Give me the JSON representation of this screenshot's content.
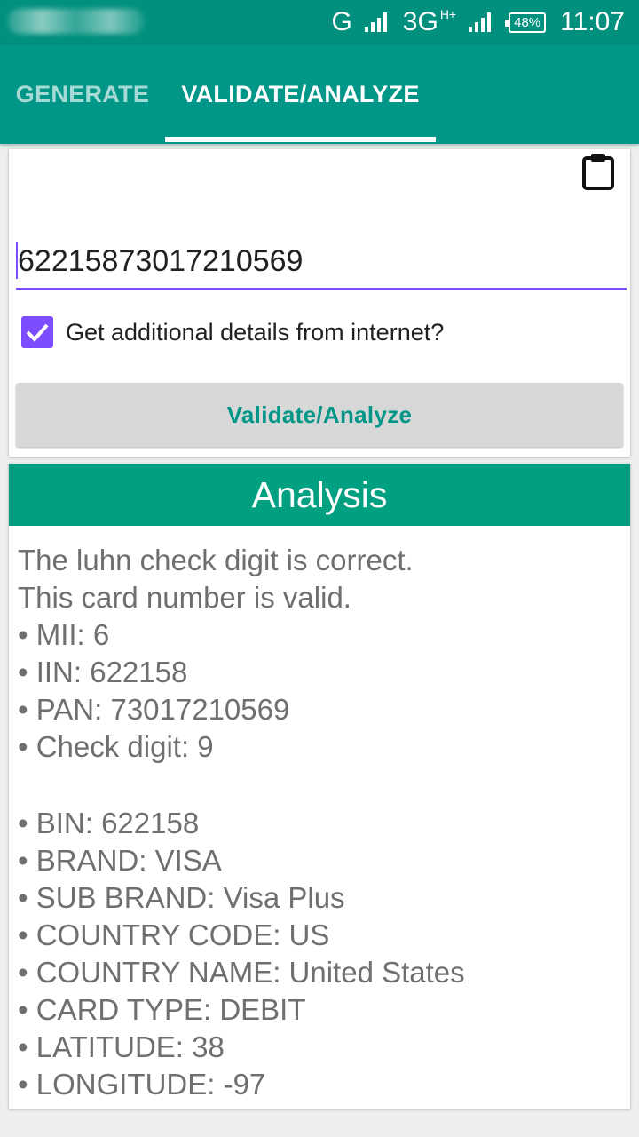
{
  "status_bar": {
    "network_g": "G",
    "network_3g": "3G",
    "network_hplus": "H+",
    "battery": "48%",
    "time": "11:07"
  },
  "tabs": [
    {
      "label": "GENERATE",
      "selected": false
    },
    {
      "label": "VALIDATE/ANALYZE",
      "selected": true
    }
  ],
  "form": {
    "card_number": "6221587301721056​9",
    "checkbox_checked": true,
    "checkbox_label": "Get additional details from internet?",
    "button_label": "Validate/Analyze"
  },
  "analysis": {
    "title": "Analysis",
    "lines": [
      "The luhn check digit is correct.",
      "This card number is valid.",
      "• MII: 6",
      "• IIN: 622158",
      "• PAN: 73017210569",
      "• Check digit: 9"
    ],
    "details": [
      "• BIN: 622158",
      "• BRAND: VISA",
      "• SUB BRAND: Visa Plus",
      "• COUNTRY CODE: US",
      "• COUNTRY NAME: United States",
      "• CARD TYPE: DEBIT",
      "• LATITUDE: 38",
      "• LONGITUDE: -97"
    ]
  },
  "colors": {
    "primary": "#009688",
    "accent": "#7c4dff",
    "header": "#00a080"
  },
  "icons": {
    "clipboard": "clipboard-icon",
    "checkbox": "check-icon"
  }
}
